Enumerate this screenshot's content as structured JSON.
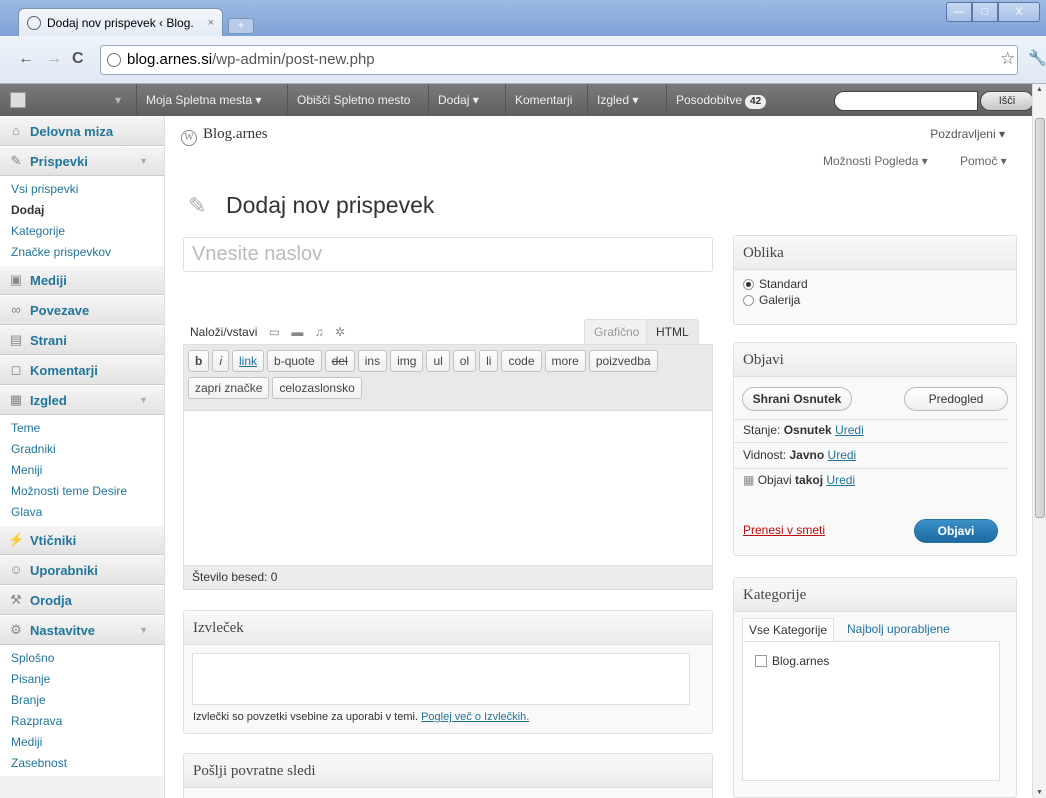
{
  "browser": {
    "tab_title": "Dodaj nov prispevek ‹ Blog.",
    "tab_close": "×",
    "new_tab": "+",
    "url_host": "blog.arnes.si",
    "url_path": "/wp-admin/post-new.php",
    "back": "←",
    "forward": "→",
    "reload": "C",
    "star": "☆",
    "wrench": "🔧",
    "window_min": "—",
    "window_max": "□",
    "window_close": "X"
  },
  "adminbar": {
    "items": [
      "Moja Spletna mesta ▾",
      "Obišči Spletno mesto",
      "Dodaj ▾",
      "Komentarji",
      "Izgled ▾",
      "Posodobitve"
    ],
    "updates_count": "42",
    "search_button": "Išči",
    "dropdown_arrow": "▾"
  },
  "sidebar": {
    "dashboard": "Delovna miza",
    "posts": "Prispevki",
    "posts_sub": [
      "Vsi prispevki",
      "Dodaj",
      "Kategorije",
      "Značke prispevkov"
    ],
    "media": "Mediji",
    "links": "Povezave",
    "pages": "Strani",
    "comments": "Komentarji",
    "appearance": "Izgled",
    "appearance_sub": [
      "Teme",
      "Gradniki",
      "Meniji",
      "Možnosti teme Desire",
      "Glava"
    ],
    "plugins": "Vtičniki",
    "users": "Uporabniki",
    "tools": "Orodja",
    "settings": "Nastavitve",
    "settings_sub": [
      "Splošno",
      "Pisanje",
      "Branje",
      "Razprava",
      "Mediji",
      "Zasebnost"
    ],
    "collapse_arrow": "▼"
  },
  "header": {
    "site_name": "Blog.arnes",
    "greeting": "Pozdravljeni ▾",
    "screen_options": "Možnosti Pogleda ▾",
    "help": "Pomoč ▾"
  },
  "editor": {
    "page_title": "Dodaj nov prispevek",
    "title_placeholder": "Vnesite naslov",
    "upload_label": "Naloži/vstavi",
    "tab_visual": "Grafično",
    "tab_html": "HTML",
    "quicktags_row1": [
      "b",
      "i",
      "link",
      "b-quote",
      "del",
      "ins",
      "img",
      "ul",
      "ol",
      "li",
      "code",
      "more",
      "poizvedba"
    ],
    "quicktags_row2": [
      "zapri značke",
      "celozaslonsko"
    ],
    "word_count": "Število besed: 0"
  },
  "excerpt": {
    "title": "Izvleček",
    "note": "Izvlečki so povzetki vsebine za uporabi v temi.",
    "note_link": "Poglej več o Izvlečkih."
  },
  "trackbacks": {
    "title": "Pošlji povratne sledi"
  },
  "format": {
    "title": "Oblika",
    "options": [
      "Standard",
      "Galerija"
    ],
    "selected": "Standard"
  },
  "publish": {
    "title": "Objavi",
    "save_draft": "Shrani Osnutek",
    "preview": "Predogled",
    "status_label": "Stanje:",
    "status_value": "Osnutek",
    "visibility_label": "Vidnost:",
    "visibility_value": "Javno",
    "schedule_label": "Objavi",
    "schedule_value": "takoj",
    "edit_link": "Uredi",
    "trash": "Prenesi v smeti",
    "publish_button": "Objavi"
  },
  "categories": {
    "title": "Kategorije",
    "tab_all": "Vse Kategorije",
    "tab_popular": "Najbolj uporabljene",
    "items": [
      "Blog.arnes"
    ]
  }
}
